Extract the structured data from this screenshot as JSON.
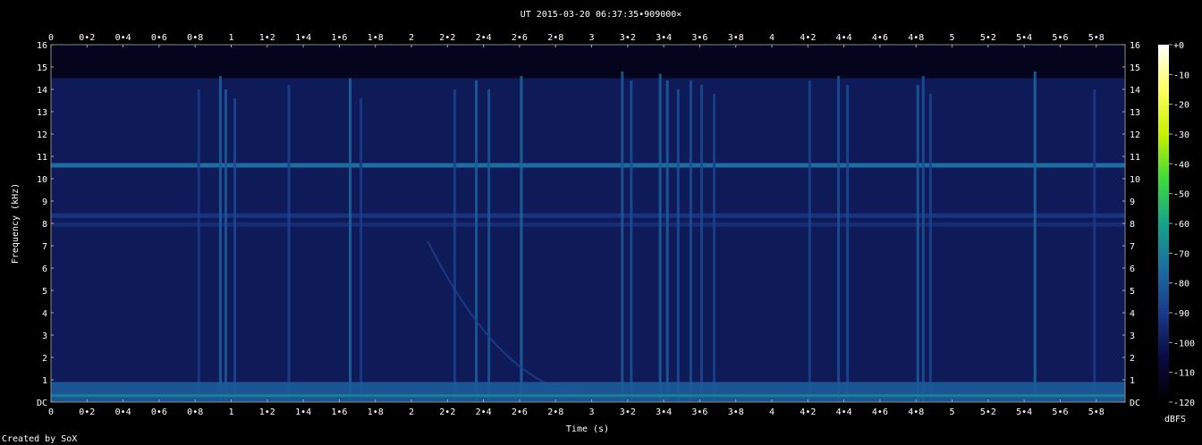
{
  "chart_data": {
    "type": "heatmap",
    "title": "UT 2015-03-20 06:37:35•909000×",
    "xlabel": "Time (s)",
    "ylabel": "Frequency (kHz)",
    "xlim": [
      0,
      5.96
    ],
    "ylim": [
      0,
      16
    ],
    "x_ticks": [
      "0",
      "0•2",
      "0•4",
      "0•6",
      "0•8",
      "1",
      "1•2",
      "1•4",
      "1•6",
      "1•8",
      "2",
      "2•2",
      "2•4",
      "2•6",
      "2•8",
      "3",
      "3•2",
      "3•4",
      "3•6",
      "3•8",
      "4",
      "4•2",
      "4•4",
      "4•6",
      "4•8",
      "5",
      "5•2",
      "5•4",
      "5•6",
      "5•8"
    ],
    "x_tick_values": [
      0,
      0.2,
      0.4,
      0.6,
      0.8,
      1,
      1.2,
      1.4,
      1.6,
      1.8,
      2,
      2.2,
      2.4,
      2.6,
      2.8,
      3,
      3.2,
      3.4,
      3.6,
      3.8,
      4,
      4.2,
      4.4,
      4.6,
      4.8,
      5,
      5.2,
      5.4,
      5.6,
      5.8
    ],
    "y_ticks": [
      "DC",
      "1",
      "2",
      "3",
      "4",
      "5",
      "6",
      "7",
      "8",
      "9",
      "10",
      "11",
      "12",
      "13",
      "14",
      "15",
      "16"
    ],
    "y_tick_values": [
      0,
      1,
      2,
      3,
      4,
      5,
      6,
      7,
      8,
      9,
      10,
      11,
      12,
      13,
      14,
      15,
      16
    ],
    "colorbar": {
      "label": "dBFS",
      "ticks": [
        "+0",
        "-10",
        "-20",
        "-30",
        "-40",
        "-50",
        "-60",
        "-70",
        "-80",
        "-90",
        "-100",
        "-110",
        "-120"
      ],
      "tick_values": [
        0,
        -10,
        -20,
        -30,
        -40,
        -50,
        -60,
        -70,
        -80,
        -90,
        -100,
        -110,
        -120
      ],
      "range": [
        -120,
        0
      ],
      "stops": [
        "#000000",
        "#0a0a40",
        "#1a3a8a",
        "#1b6ea0",
        "#15a58a",
        "#3ddc3a",
        "#c8f000",
        "#ffff60",
        "#ffffff"
      ]
    },
    "background_level_dbfs": -100,
    "horizontal_tones": [
      {
        "freq_khz": 10.6,
        "level_dbfs": -75
      },
      {
        "freq_khz": 8.35,
        "level_dbfs": -92
      },
      {
        "freq_khz": 7.95,
        "level_dbfs": -94
      }
    ],
    "impulses": [
      {
        "t": 0.82,
        "fmax_khz": 14,
        "level_dbfs": -90
      },
      {
        "t": 0.94,
        "fmax_khz": 14.6,
        "level_dbfs": -80
      },
      {
        "t": 0.97,
        "fmax_khz": 14.0,
        "level_dbfs": -82
      },
      {
        "t": 1.02,
        "fmax_khz": 13.6,
        "level_dbfs": -86
      },
      {
        "t": 1.32,
        "fmax_khz": 14.2,
        "level_dbfs": -88
      },
      {
        "t": 1.66,
        "fmax_khz": 14.5,
        "level_dbfs": -78
      },
      {
        "t": 1.72,
        "fmax_khz": 13.6,
        "level_dbfs": -90
      },
      {
        "t": 2.24,
        "fmax_khz": 14.0,
        "level_dbfs": -88
      },
      {
        "t": 2.36,
        "fmax_khz": 14.4,
        "level_dbfs": -80
      },
      {
        "t": 2.43,
        "fmax_khz": 14.0,
        "level_dbfs": -82
      },
      {
        "t": 2.61,
        "fmax_khz": 14.6,
        "level_dbfs": -78
      },
      {
        "t": 3.17,
        "fmax_khz": 14.8,
        "level_dbfs": -82
      },
      {
        "t": 3.22,
        "fmax_khz": 14.4,
        "level_dbfs": -84
      },
      {
        "t": 3.38,
        "fmax_khz": 14.7,
        "level_dbfs": -80
      },
      {
        "t": 3.42,
        "fmax_khz": 14.4,
        "level_dbfs": -80
      },
      {
        "t": 3.48,
        "fmax_khz": 14.0,
        "level_dbfs": -84
      },
      {
        "t": 3.55,
        "fmax_khz": 14.4,
        "level_dbfs": -84
      },
      {
        "t": 3.61,
        "fmax_khz": 14.2,
        "level_dbfs": -86
      },
      {
        "t": 3.68,
        "fmax_khz": 13.8,
        "level_dbfs": -88
      },
      {
        "t": 4.21,
        "fmax_khz": 14.4,
        "level_dbfs": -88
      },
      {
        "t": 4.37,
        "fmax_khz": 14.6,
        "level_dbfs": -84
      },
      {
        "t": 4.42,
        "fmax_khz": 14.2,
        "level_dbfs": -86
      },
      {
        "t": 4.81,
        "fmax_khz": 14.2,
        "level_dbfs": -82
      },
      {
        "t": 4.84,
        "fmax_khz": 14.6,
        "level_dbfs": -84
      },
      {
        "t": 4.88,
        "fmax_khz": 13.8,
        "level_dbfs": -88
      },
      {
        "t": 5.46,
        "fmax_khz": 14.8,
        "level_dbfs": -78
      },
      {
        "t": 5.79,
        "fmax_khz": 14.0,
        "level_dbfs": -90
      }
    ],
    "whistler": {
      "t_start": 2.09,
      "f_start_khz": 7.2,
      "t_end": 3.05,
      "f_end_khz": 0.3,
      "level_dbfs": -88
    }
  },
  "credit": "Created by SoX"
}
